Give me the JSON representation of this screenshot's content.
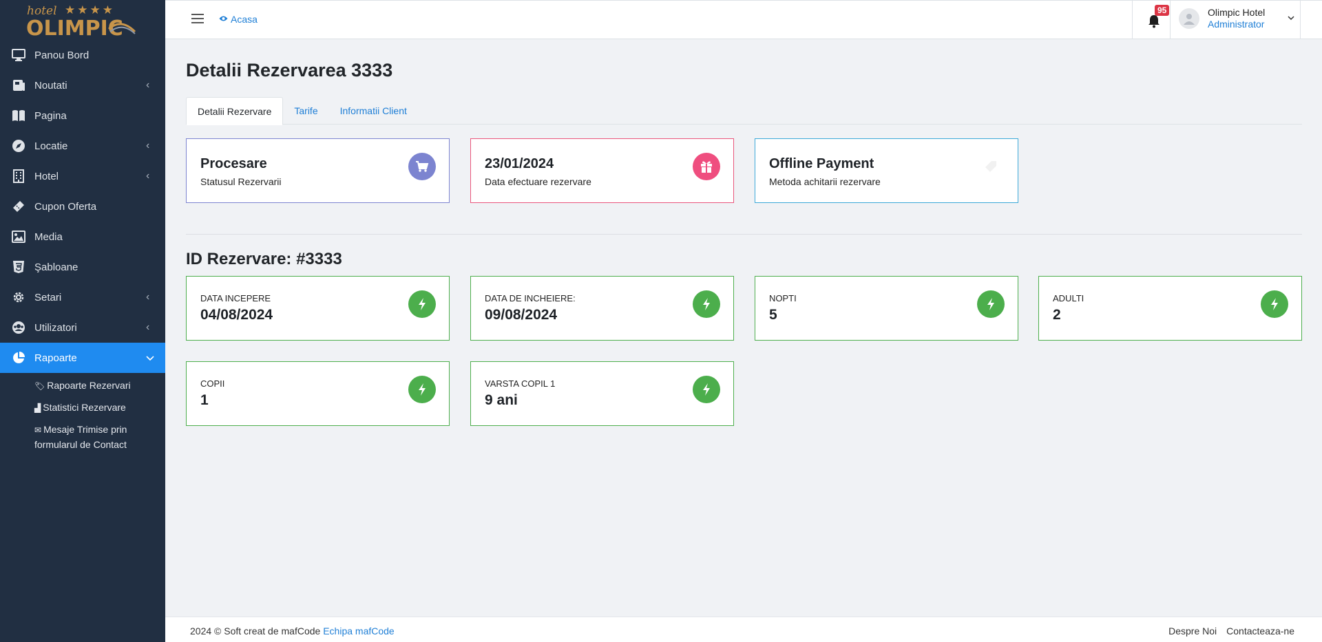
{
  "logo": {
    "hotel": "hotel",
    "stars": "★★★★",
    "name": "OLIMPIC"
  },
  "sidebar": {
    "items": [
      {
        "label": "Panou Bord",
        "icon": "monitor-icon"
      },
      {
        "label": "Noutati",
        "icon": "newspaper-icon",
        "chevron": "‹"
      },
      {
        "label": "Pagina",
        "icon": "book-icon"
      },
      {
        "label": "Locatie",
        "icon": "compass-icon",
        "chevron": "‹"
      },
      {
        "label": "Hotel",
        "icon": "building-icon",
        "chevron": "‹"
      },
      {
        "label": "Cupon Oferta",
        "icon": "ticket-icon"
      },
      {
        "label": "Media",
        "icon": "image-icon"
      },
      {
        "label": "Şabloane",
        "icon": "html5-icon"
      },
      {
        "label": "Setari",
        "icon": "gear-icon",
        "chevron": "‹"
      },
      {
        "label": "Utilizatori",
        "icon": "users-icon",
        "chevron": "‹"
      },
      {
        "label": "Rapoarte",
        "icon": "pie-chart-icon",
        "chevron": "⌄"
      }
    ],
    "subitems": [
      {
        "label": "Rapoarte Rezervari",
        "icon": "tag-icon"
      },
      {
        "label": "Statistici Rezervare",
        "icon": "bar-chart-icon"
      },
      {
        "label": "Mesaje Trimise prin formularul de Contact",
        "icon": "envelope-icon"
      }
    ]
  },
  "topbar": {
    "breadcrumb": "Acasa",
    "notification_count": "95",
    "user_name": "Olimpic Hotel",
    "user_role": "Administrator"
  },
  "page": {
    "title": "Detalii Rezervarea 3333",
    "tabs": [
      "Detalii Rezervare",
      "Tarife",
      "Informatii Client"
    ],
    "summary_cards": [
      {
        "title": "Procesare",
        "subtitle": "Statusul Rezervarii",
        "icon": "cart-icon",
        "color": "#7c84d0",
        "border": "#7c84d0"
      },
      {
        "title": "23/01/2024",
        "subtitle": "Data efectuare rezervare",
        "icon": "gift-icon",
        "color": "#ef4e7f",
        "border": "#e9557b"
      },
      {
        "title": "Offline Payment",
        "subtitle": "Metoda achitarii rezervare",
        "icon": "tag-icon",
        "color": "#ffffff",
        "border": "#3aa8d8"
      }
    ],
    "section_title": "ID Rezervare: #3333",
    "info_cards": [
      {
        "label": "DATA INCEPERE",
        "value": "04/08/2024"
      },
      {
        "label": "DATA DE INCHEIERE:",
        "value": "09/08/2024"
      },
      {
        "label": "NOPTI",
        "value": "5"
      },
      {
        "label": "ADULTI",
        "value": "2"
      },
      {
        "label": "COPII",
        "value": "1"
      },
      {
        "label": "VARSTA COPIL 1",
        "value": "9 ani"
      }
    ],
    "info_color": "#4cae4c"
  },
  "footer": {
    "copyright": "2024 © Soft creat de mafCode",
    "team_link": "Echipa mafCode",
    "links": [
      "Despre Noi",
      "Contacteaza-ne"
    ]
  }
}
